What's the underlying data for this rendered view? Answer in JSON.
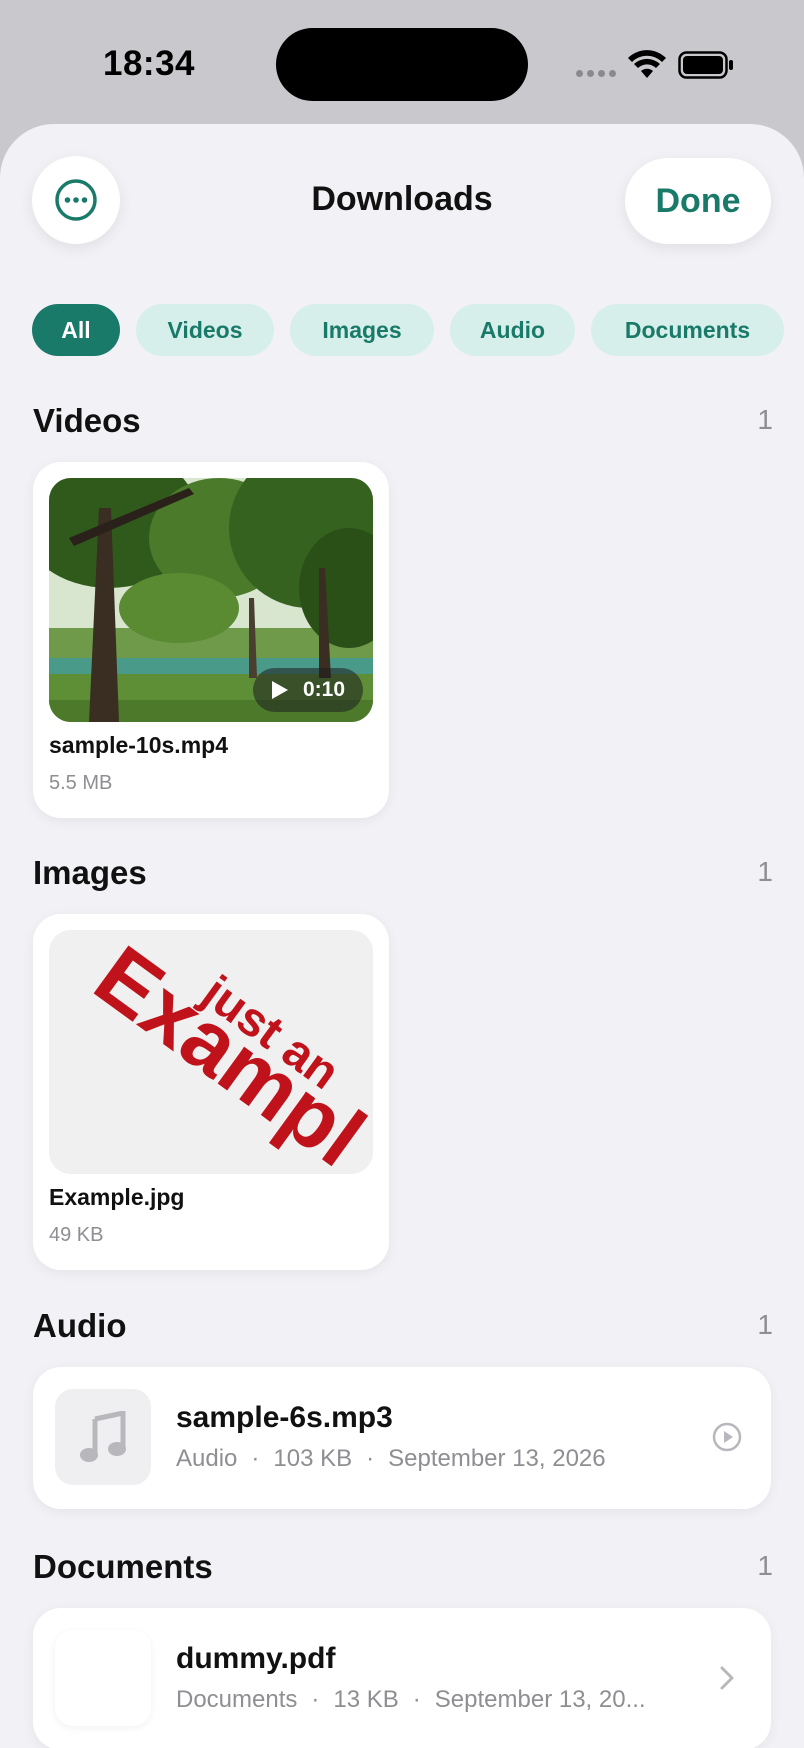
{
  "status_bar": {
    "time": "18:34"
  },
  "header": {
    "title": "Downloads",
    "done_label": "Done"
  },
  "filters": [
    "All",
    "Videos",
    "Images",
    "Audio",
    "Documents"
  ],
  "sections": {
    "videos": {
      "title": "Videos",
      "count": "1",
      "item": {
        "name": "sample-10s.mp4",
        "size": "5.5 MB",
        "duration": "0:10"
      }
    },
    "images": {
      "title": "Images",
      "count": "1",
      "item": {
        "name": "Example.jpg",
        "size": "49 KB",
        "thumb_text_1": "just an",
        "thumb_text_2": "Exampl"
      }
    },
    "audio": {
      "title": "Audio",
      "count": "1",
      "item": {
        "name": "sample-6s.mp3",
        "type": "Audio",
        "size": "103 KB",
        "date": "September 13, 2026"
      }
    },
    "documents": {
      "title": "Documents",
      "count": "1",
      "item": {
        "name": "dummy.pdf",
        "type": "Documents",
        "size": "13 KB",
        "date": "September 13, 20..."
      }
    }
  },
  "colors": {
    "accent": "#1a7a6a",
    "chip_bg": "#d6efea",
    "sheet_bg": "#f2f2f6",
    "image_text": "#c0121a"
  }
}
